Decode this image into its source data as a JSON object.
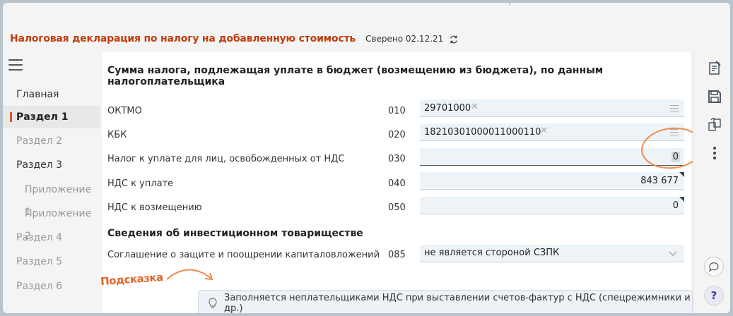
{
  "header": {
    "title": "Налоговая декларация по налогу на добавленную стоимость",
    "verified": "Сверено 02.12.21"
  },
  "sidebar": {
    "items": [
      {
        "label": "Главная"
      },
      {
        "label": "Раздел 1"
      },
      {
        "label": "Раздел 2"
      },
      {
        "label": "Раздел 3"
      },
      {
        "label": "Приложение 1"
      },
      {
        "label": "Приложение 2"
      },
      {
        "label": "Раздел 4"
      },
      {
        "label": "Раздел 5"
      },
      {
        "label": "Раздел 6"
      }
    ]
  },
  "main": {
    "section_title": "Сумма налога, подлежащая уплате в бюджет (возмещению из бюджета), по данным налогоплательщика",
    "rows": [
      {
        "label": "ОКТМО",
        "code": "010",
        "value": "29701000"
      },
      {
        "label": "КБК",
        "code": "020",
        "value": "18210301000011000110"
      },
      {
        "label": "Налог к уплате для лиц, освобожденных от НДС",
        "code": "030",
        "value": "0"
      },
      {
        "label": "НДС к уплате",
        "code": "040",
        "value": "843 677"
      },
      {
        "label": "НДС к возмещению",
        "code": "050",
        "value": "0"
      }
    ],
    "subheading": "Сведения об инвестиционном товариществе",
    "agreement": {
      "label": "Соглашение о защите и поощрении капиталовложений",
      "code": "085",
      "value": "не является стороной СЗПК"
    }
  },
  "annotation": {
    "hint_label": "Подсказка"
  },
  "tooltip": {
    "text": "Заполняется неплательщиками НДС при выставлении счетов-фактур с НДС (спецрежимники и др.)"
  },
  "rightbar": {
    "help": "?"
  },
  "colors": {
    "brand": "#c23d0c",
    "accent": "#d7572a",
    "annotation": "#ef8a4a",
    "field_bg": "#eef3f7"
  }
}
